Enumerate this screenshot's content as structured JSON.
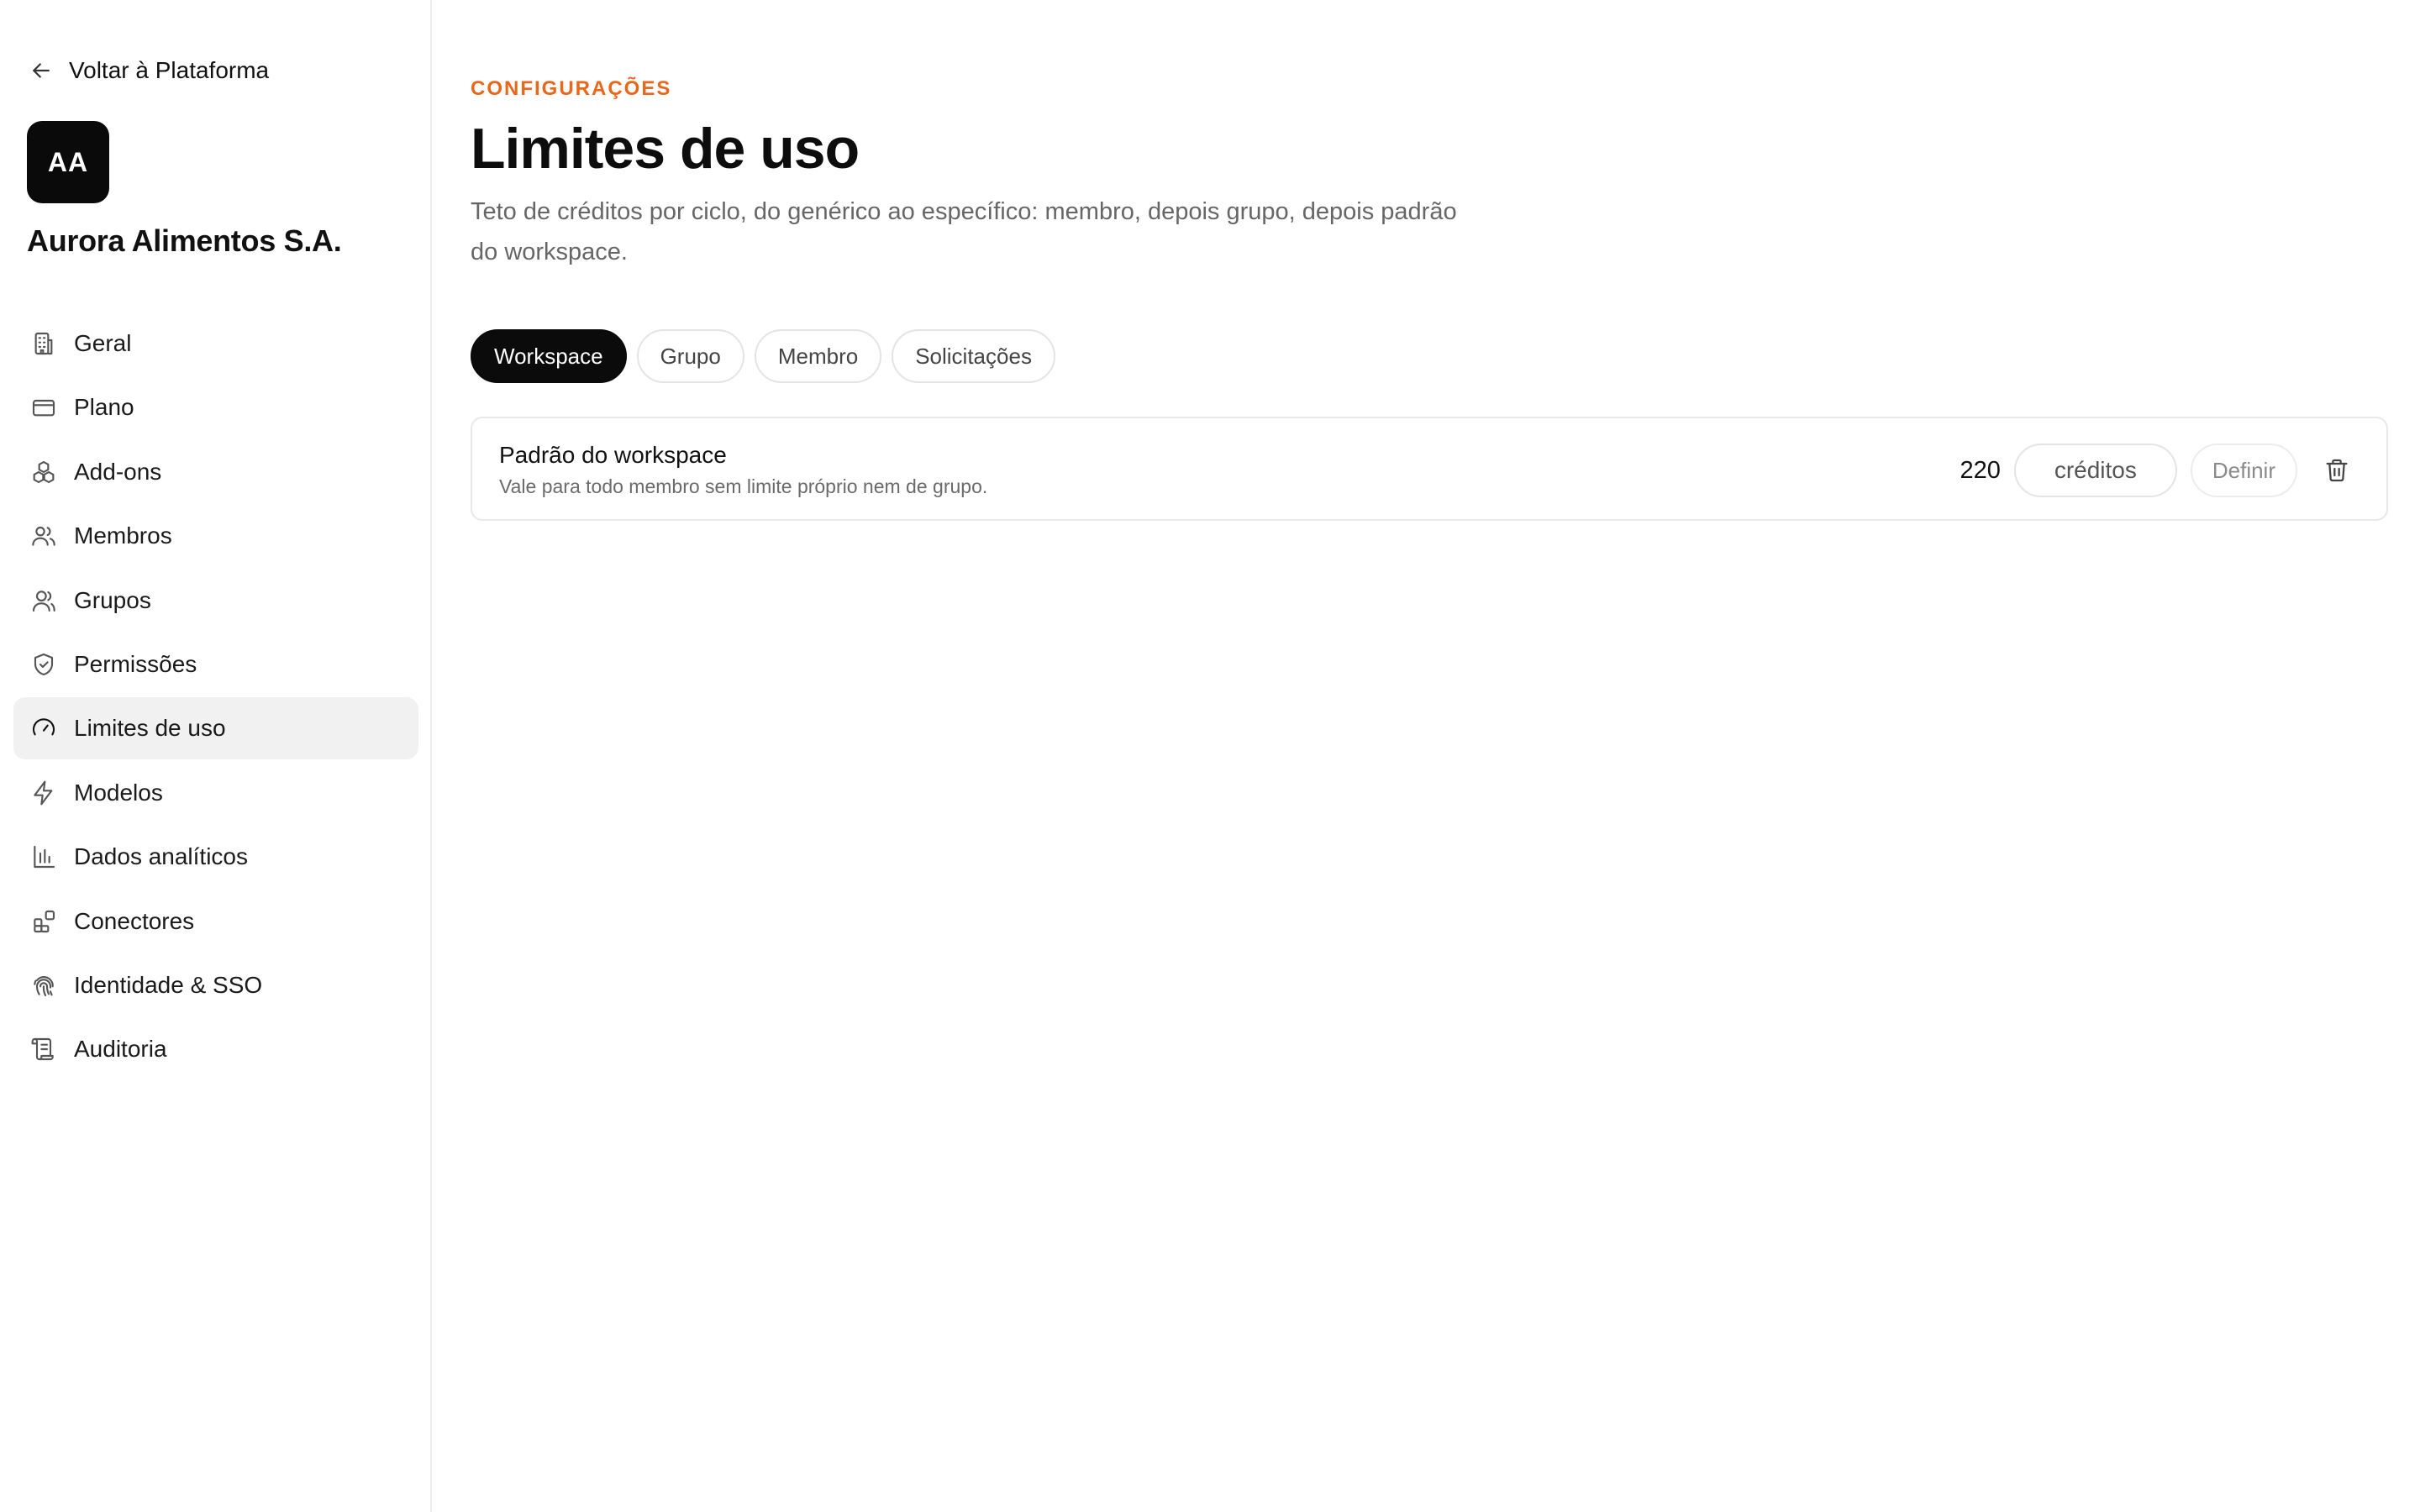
{
  "sidebar": {
    "back_label": "Voltar à Plataforma",
    "org_initials": "AA",
    "org_name": "Aurora Alimentos S.A.",
    "items": [
      {
        "label": "Geral",
        "icon": "building-icon"
      },
      {
        "label": "Plano",
        "icon": "credit-card-icon"
      },
      {
        "label": "Add-ons",
        "icon": "boxes-icon"
      },
      {
        "label": "Membros",
        "icon": "users-icon"
      },
      {
        "label": "Grupos",
        "icon": "user-group-icon"
      },
      {
        "label": "Permissões",
        "icon": "shield-check-icon"
      },
      {
        "label": "Limites de uso",
        "icon": "gauge-icon",
        "active": true
      },
      {
        "label": "Modelos",
        "icon": "zap-icon"
      },
      {
        "label": "Dados analíticos",
        "icon": "bar-chart-icon"
      },
      {
        "label": "Conectores",
        "icon": "blocks-icon"
      },
      {
        "label": "Identidade & SSO",
        "icon": "fingerprint-icon"
      },
      {
        "label": "Auditoria",
        "icon": "scroll-icon"
      }
    ]
  },
  "header": {
    "eyebrow": "CONFIGURAÇÕES",
    "title": "Limites de uso",
    "description": "Teto de créditos por ciclo, do genérico ao específico: membro, depois grupo, depois padrão do workspace."
  },
  "tabs": [
    {
      "label": "Workspace",
      "active": true
    },
    {
      "label": "Grupo"
    },
    {
      "label": "Membro"
    },
    {
      "label": "Solicitações"
    }
  ],
  "limit_card": {
    "title": "Padrão do workspace",
    "subtitle": "Vale para todo membro sem limite próprio nem de grupo.",
    "value": "220",
    "unit": "créditos",
    "define_label": "Definir"
  },
  "colors": {
    "accent": "#e8671a",
    "active_tab_bg": "#0b0b0b",
    "active_nav_bg": "#f1f1f1"
  }
}
